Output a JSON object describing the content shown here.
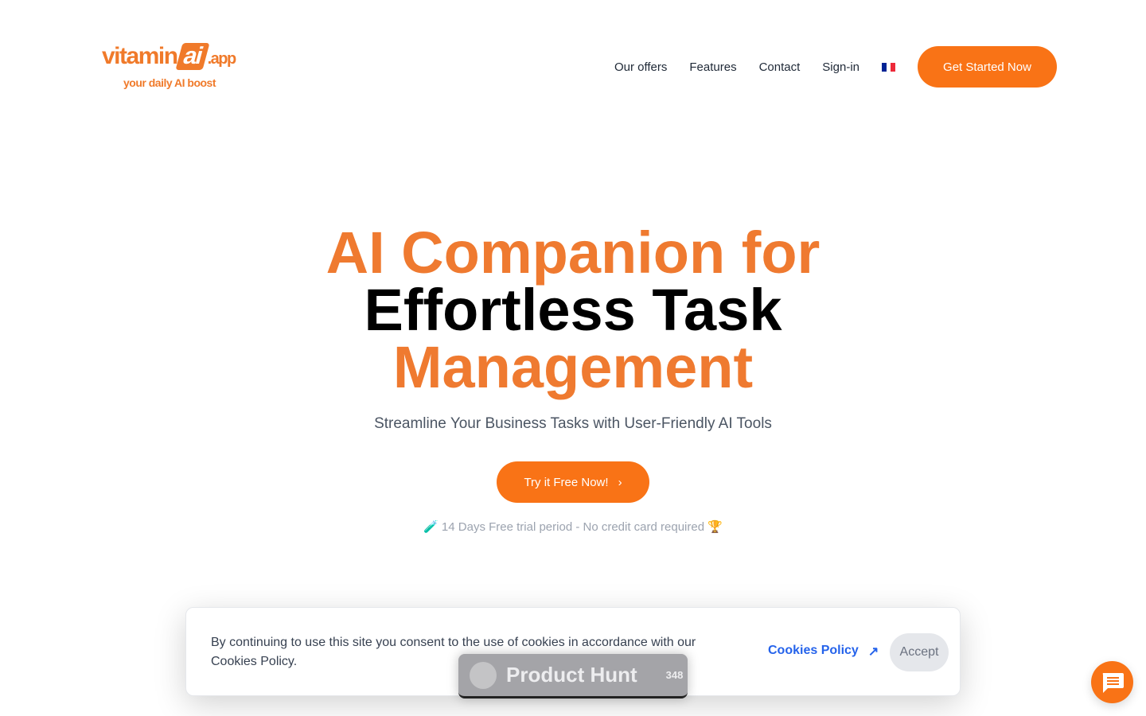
{
  "brand": {
    "name_part1": "vitamin",
    "name_ai": "ai",
    "name_suffix": ".app",
    "tagline": "your daily AI boost",
    "accent": "#f97316"
  },
  "nav": {
    "items": [
      "Our offers",
      "Features",
      "Contact",
      "Sign-in"
    ],
    "language": "fr-flag",
    "cta": "Get Started Now"
  },
  "hero": {
    "title_line1": "AI Companion for",
    "title_line2": "Effortless Task",
    "title_line3": "Management",
    "subtitle": "Streamline Your Business Tasks with User-Friendly AI Tools",
    "button": "Try it Free Now!",
    "trial_icon_left": "🧪",
    "trial": "14 Days Free trial period - No credit card required",
    "trial_icon_right": "🏆"
  },
  "product_hunt": {
    "label": "Product Hunt",
    "count": "348"
  },
  "cookie": {
    "text": "By continuing to use this site you consent to the use of cookies in accordance with our Cookies Policy.",
    "policy_link": "Cookies Policy",
    "accept": "Accept"
  },
  "chat": {
    "icon": "chat-icon"
  }
}
